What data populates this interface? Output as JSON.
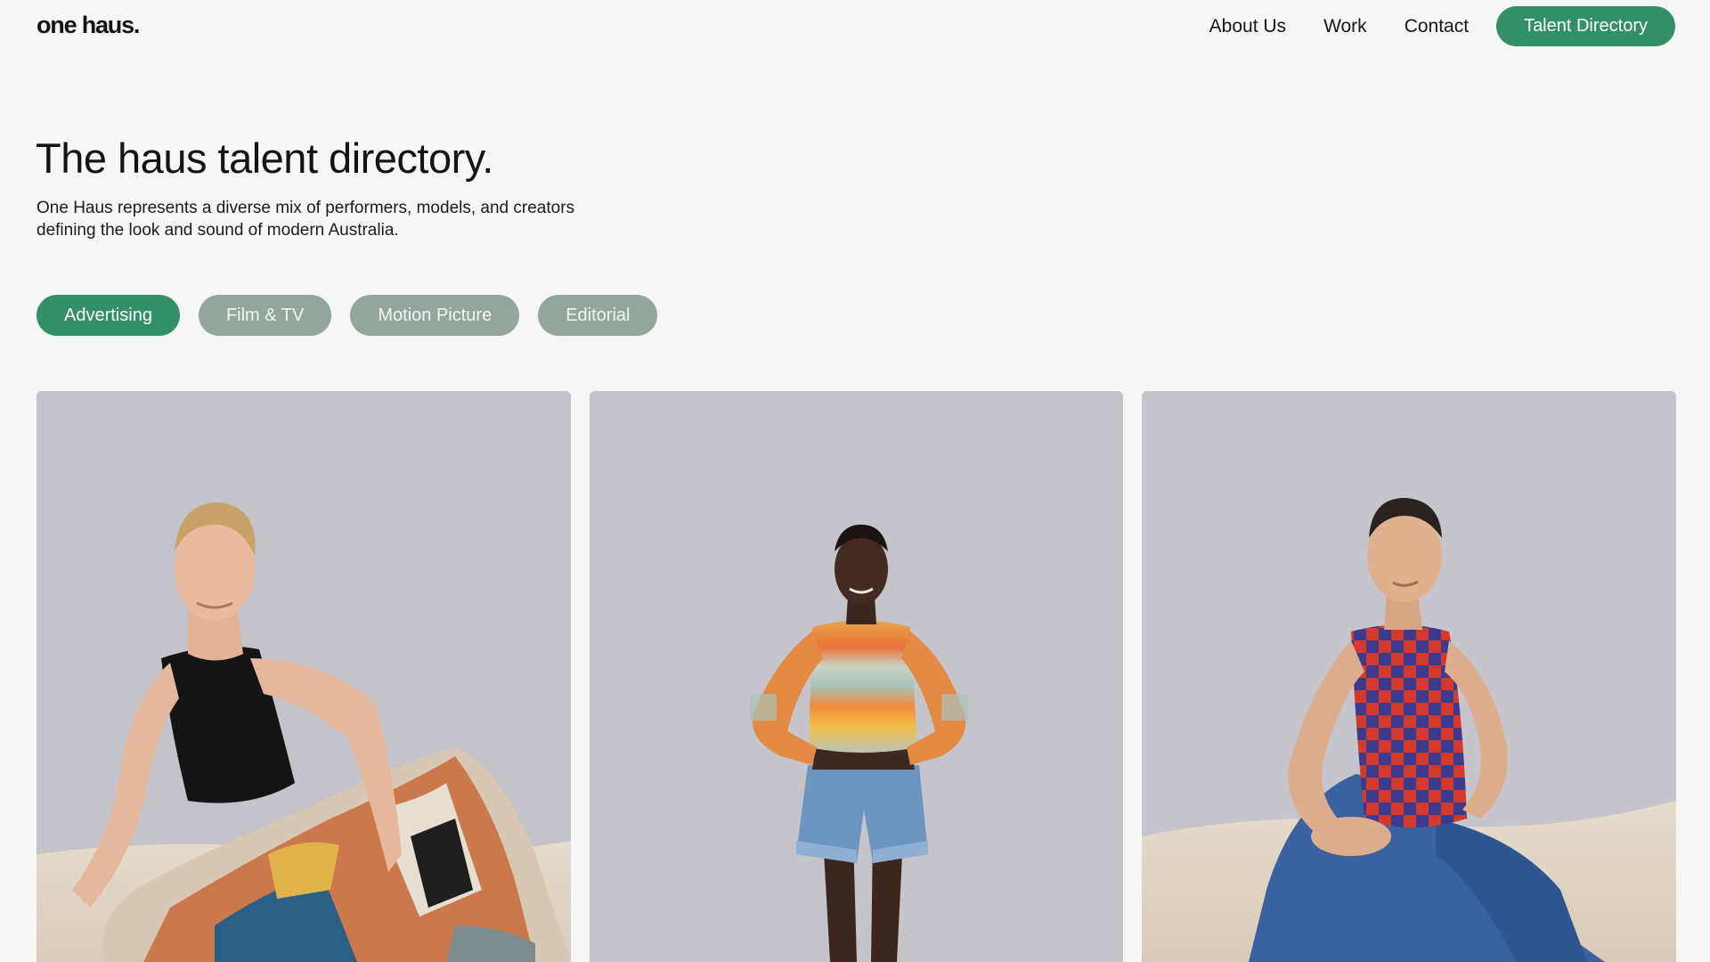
{
  "header": {
    "logo": "one haus.",
    "nav": {
      "about": "About Us",
      "work": "Work",
      "contact": "Contact",
      "cta": "Talent Directory"
    }
  },
  "hero": {
    "title": "The haus talent directory.",
    "description": "One Haus represents a diverse mix of performers, models, and creators defining the look and sound of modern Australia."
  },
  "filters": {
    "active": "Advertising",
    "items": [
      "Advertising",
      "Film & TV",
      "Motion Picture",
      "Editorial"
    ]
  },
  "talent_cards": [
    {
      "photo": "portrait-seated-black-tank-top"
    },
    {
      "photo": "portrait-standing-striped-sweater"
    },
    {
      "photo": "portrait-seated-checkered-top"
    }
  ],
  "colors": {
    "accent": "#338f68",
    "pill_inactive": "#93a59c",
    "background": "#f6f6f6"
  }
}
